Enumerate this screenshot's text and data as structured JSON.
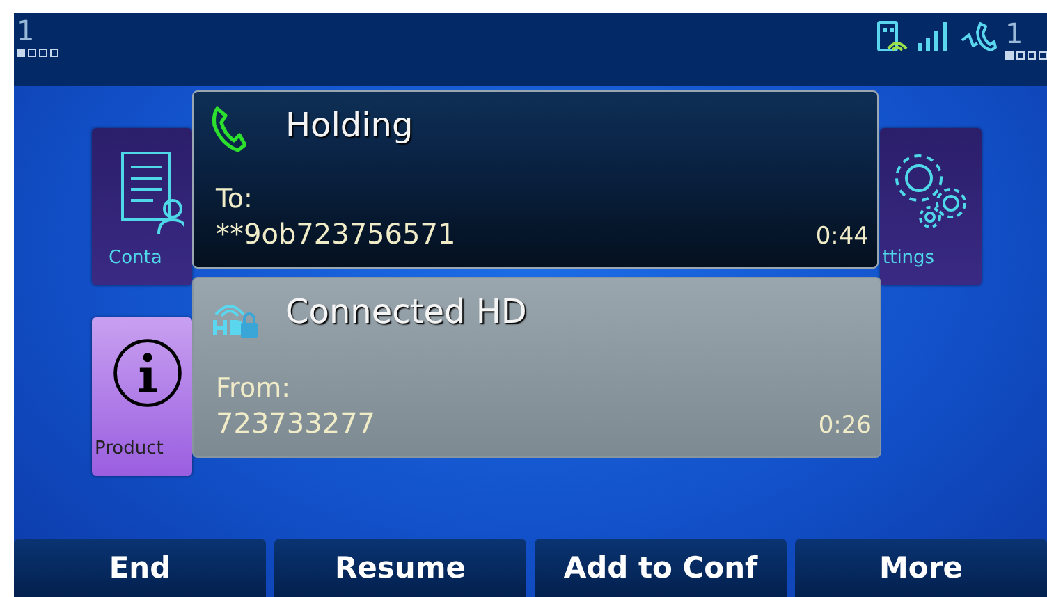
{
  "status_bar": {
    "left_line": "1",
    "left_keys": [
      {
        "selected": true
      },
      {
        "selected": false
      },
      {
        "selected": false
      },
      {
        "selected": false
      }
    ],
    "right_line": "1",
    "right_keys": [
      {
        "selected": true
      },
      {
        "selected": false
      },
      {
        "selected": false
      },
      {
        "selected": false
      }
    ]
  },
  "tiles": [
    {
      "kind": "contacts",
      "label": "Conta"
    },
    {
      "kind": "settings",
      "label": "ttings"
    },
    {
      "kind": "product",
      "label": "Product"
    }
  ],
  "calls": [
    {
      "kind": "holding",
      "status": "Holding",
      "direction": "To:",
      "number": "**9ob723756571",
      "duration": "0:44"
    },
    {
      "kind": "connected",
      "status": "Connected HD",
      "direction": "From:",
      "number": "723733277",
      "duration": "0:26"
    }
  ],
  "softkeys": [
    "End",
    "Resume",
    "Add to Conf",
    "More"
  ]
}
